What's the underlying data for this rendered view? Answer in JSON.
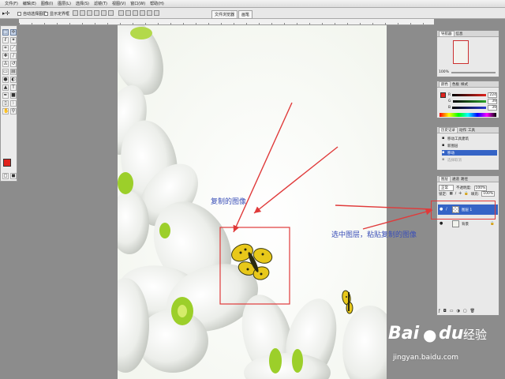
{
  "menu": [
    "文件(F)",
    "编辑(E)",
    "图像(I)",
    "图层(L)",
    "选择(S)",
    "滤镜(T)",
    "视图(V)",
    "窗口(W)",
    "帮助(H)"
  ],
  "options": {
    "auto_select_label": "自动选择图层",
    "show_bounds_label": "显示定界框",
    "dock_tabs": [
      "文件浏览器",
      "画笔"
    ]
  },
  "panels": {
    "navigator": {
      "tabs": [
        "导航器",
        "信息"
      ],
      "zoom": "100%"
    },
    "color": {
      "tabs": [
        "颜色",
        "色板",
        "样式"
      ],
      "channels": [
        {
          "label": "R",
          "value": "224",
          "color": "#e0231d"
        },
        {
          "label": "G",
          "value": "39",
          "color": "#2aa52a"
        },
        {
          "label": "B",
          "value": "39",
          "color": "#2a3ad0"
        }
      ]
    },
    "history": {
      "tabs": [
        "历史记录",
        "动作",
        "工具"
      ],
      "items": [
        "移动工具建筑",
        "新图层",
        "移动",
        "选择取消"
      ],
      "selected_index": 2
    },
    "layers": {
      "tabs": [
        "图层",
        "通道",
        "路径"
      ],
      "blend_mode": "正常",
      "opacity_label": "不透明度:",
      "opacity": "100%",
      "lock_label": "锁定:",
      "fill_label": "填充:",
      "fill": "100%",
      "items": [
        {
          "name": "图层 1",
          "selected": true
        },
        {
          "name": "背景",
          "selected": false
        }
      ]
    }
  },
  "annotations": {
    "copied_image": "复制的图像",
    "select_and_paste": "选中图层，粘贴复制的图像",
    "arrow_color": "#e03a3a"
  },
  "watermark": {
    "brand": "Bai",
    "brand_cn": "经验",
    "url": "jingyan.baidu.com"
  },
  "colors": {
    "workspace": "#8c8c8c",
    "selection_blue": "#3564c6",
    "foreground": "#e0231d"
  }
}
